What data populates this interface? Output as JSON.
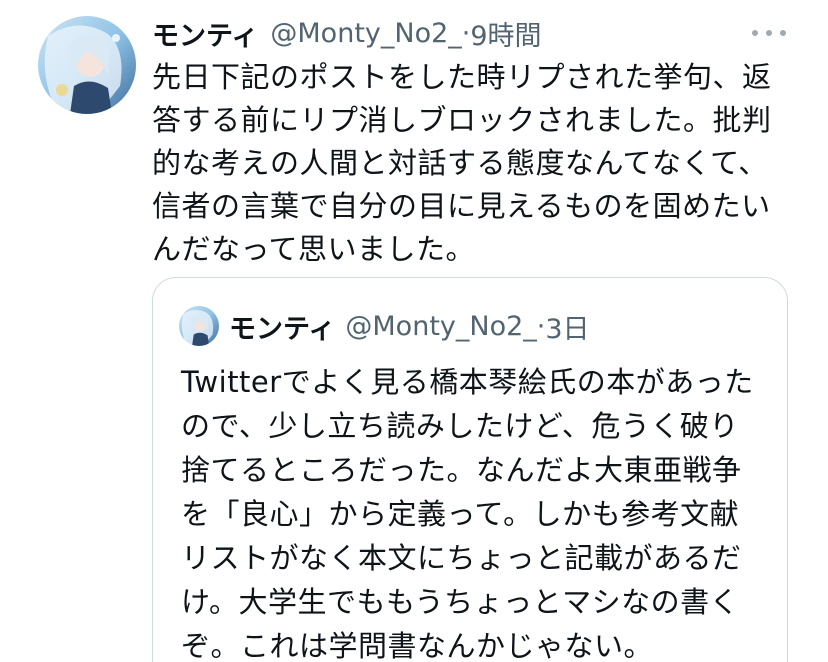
{
  "tweet": {
    "display_name": "モンティ",
    "handle": "@Monty_No2_",
    "separator": "·",
    "time": "9時間",
    "more_icon": "more-horizontal-icon",
    "text": "先日下記のポストをした時リプされた挙句、返答する前にリプ消しブロックされました。批判的な考えの人間と対話する態度なんてなくて、信者の言葉で自分の目に見えるものを固めたいんだなって思いました。"
  },
  "quoted_tweet": {
    "display_name": "モンティ",
    "handle": "@Monty_No2_",
    "separator": "·",
    "time": "3日",
    "text": "Twitterでよく見る橋本琴絵氏の本があったので、少し立ち読みしたけど、危うく破り捨てるところだった。なんだよ大東亜戦争を「良心」から定義って。しかも参考文献リストがなく本文にちょっと記載があるだけ。大学生でももうちょっとマシなの書くぞ。これは学問書なんかじゃない。"
  },
  "colors": {
    "text_primary": "#0f1419",
    "text_secondary": "#536471",
    "border": "#cfd9de"
  }
}
